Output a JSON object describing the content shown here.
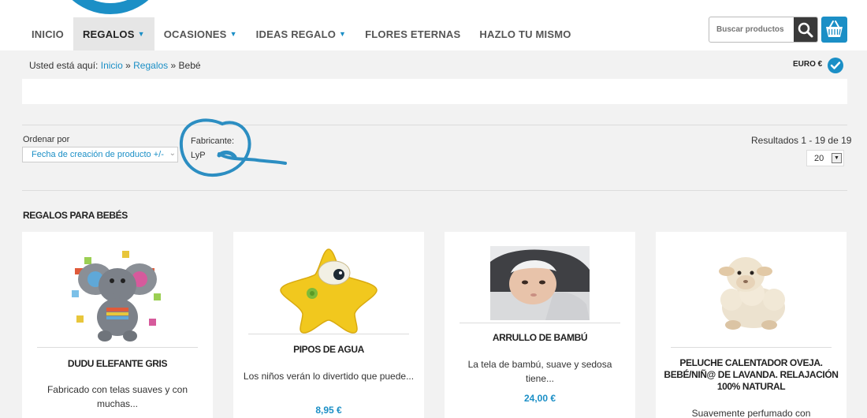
{
  "nav": {
    "items": [
      {
        "label": "INICIO",
        "dropdown": false
      },
      {
        "label": "REGALOS",
        "dropdown": true,
        "active": true
      },
      {
        "label": "OCASIONES",
        "dropdown": true
      },
      {
        "label": "IDEAS REGALO",
        "dropdown": true
      },
      {
        "label": "FLORES ETERNAS",
        "dropdown": false
      },
      {
        "label": "HAZLO TU MISMO",
        "dropdown": false
      }
    ]
  },
  "search": {
    "placeholder": "Buscar productos",
    "icon": "search-icon"
  },
  "cart": {
    "icon": "basket-icon"
  },
  "breadcrumb": {
    "prefix": "Usted está aquí:",
    "home": "Inicio",
    "sep": "»",
    "parent": "Regalos",
    "current": "Bebé"
  },
  "currency": {
    "label": "EURO €",
    "icon": "check-circle-icon"
  },
  "filters": {
    "order_label": "Ordenar por",
    "order_value": "Fecha de creación de producto +/-",
    "manufacturer_label": "Fabricante:",
    "manufacturer_value": "LyP",
    "results_text": "Resultados 1 - 19 de 19",
    "limit_value": "20"
  },
  "section": {
    "title": "REGALOS PARA BEBÉS"
  },
  "products": [
    {
      "name": "DUDU ELEFANTE GRIS",
      "desc": "Fabricado con telas suaves y con muchas...",
      "price": ""
    },
    {
      "name": "PIPOS DE AGUA",
      "desc": "Los niños verán lo divertido que puede...",
      "price": "8,95 €"
    },
    {
      "name": "ARRULLO DE BAMBÚ",
      "desc": "La tela de bambú, suave y sedosa tiene...",
      "price": "24,00 €"
    },
    {
      "name": "PELUCHE CALENTADOR OVEJA. BEBÉ/NIÑ@ DE LAVANDA. RELAJACIÓN 100% NATURAL",
      "desc": "Suavemente perfumado con",
      "price": ""
    }
  ],
  "colors": {
    "accent": "#1b8fc6",
    "annotation": "#2c8ec2"
  }
}
